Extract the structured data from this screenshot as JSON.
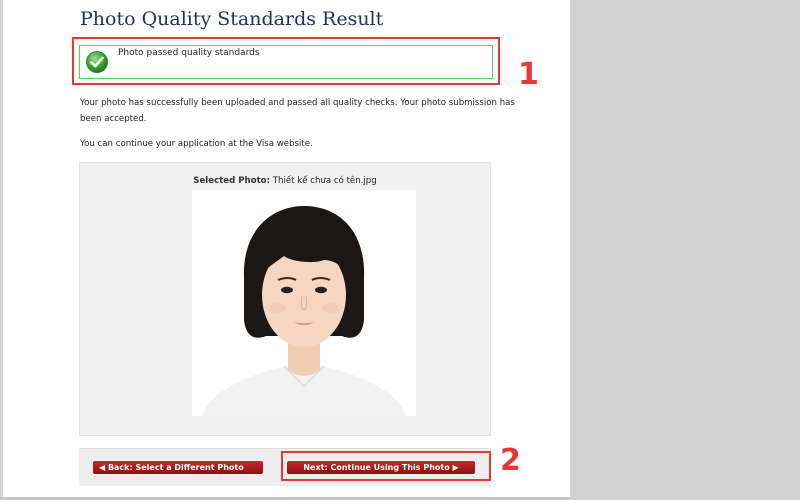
{
  "page": {
    "title": "Photo Quality Standards Result"
  },
  "status": {
    "message": "Photo passed quality standards",
    "icon": "check-circle-icon",
    "border_color": "#5ccf5c"
  },
  "body": {
    "paragraph1": "Your photo has successfully been uploaded and passed all quality checks. Your photo submission has been accepted.",
    "paragraph2": "You can continue your application at the Visa website."
  },
  "photo": {
    "selected_label": "Selected Photo:",
    "filename": "Thiết kế chưa có tên.jpg"
  },
  "buttons": {
    "back_label": "Back: Select a Different Photo",
    "next_label": "Next: Continue Using This Photo",
    "color": "#a81c1c"
  },
  "annotations": {
    "marker1": "1",
    "marker2": "2",
    "color": "#e53935"
  }
}
